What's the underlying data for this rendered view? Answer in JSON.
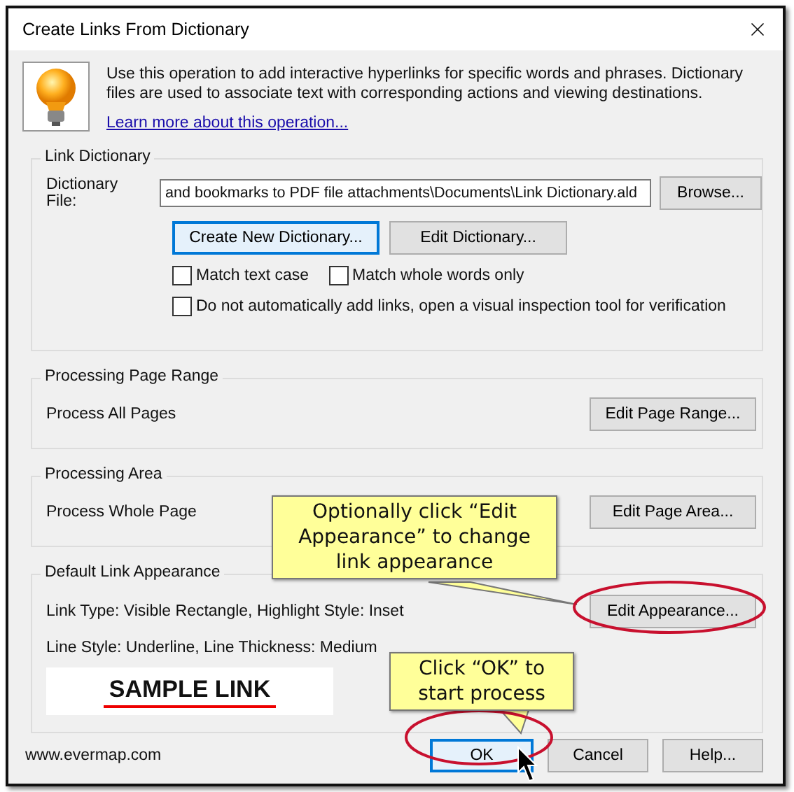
{
  "window": {
    "title": "Create Links From Dictionary"
  },
  "intro": {
    "text": "Use this operation to add interactive hyperlinks for specific words and phrases. Dictionary files are used to associate text with corresponding actions and viewing destinations.",
    "link": "Learn more about this operation..."
  },
  "link_dictionary": {
    "title": "Link Dictionary",
    "file_label": "Dictionary File:",
    "file_value": "and bookmarks to PDF file attachments\\Documents\\Link Dictionary.ald",
    "browse": "Browse...",
    "buttons": [
      {
        "label": "Create New Dictionary...",
        "focused": true
      },
      {
        "label": "Edit Dictionary...",
        "focused": false
      }
    ],
    "options": [
      {
        "label": "Match text case",
        "checked": false
      },
      {
        "label": "Match whole words only",
        "checked": false
      },
      {
        "label": "Do not automatically add links, open a visual inspection tool for verification",
        "checked": false
      }
    ]
  },
  "page_range": {
    "title": "Processing Page Range",
    "value": "Process All Pages",
    "button": "Edit Page Range..."
  },
  "area": {
    "title": "Processing Area",
    "value": "Process Whole Page",
    "button": "Edit Page Area..."
  },
  "appearance": {
    "title": "Default Link Appearance",
    "lines": [
      "Link Type: Visible Rectangle, Highlight Style: Inset",
      "Line Style: Underline, Line Thickness: Medium"
    ],
    "sample": "SAMPLE LINK",
    "button": "Edit Appearance..."
  },
  "footer": {
    "site": "www.evermap.com",
    "buttons": [
      {
        "label": "OK",
        "focused": true
      },
      {
        "label": "Cancel",
        "focused": false
      },
      {
        "label": "Help...",
        "focused": false
      }
    ]
  },
  "callouts": [
    {
      "text": "Optionally click “Edit Appearance” to change link appearance"
    },
    {
      "text": "Click “OK” to start process"
    }
  ]
}
